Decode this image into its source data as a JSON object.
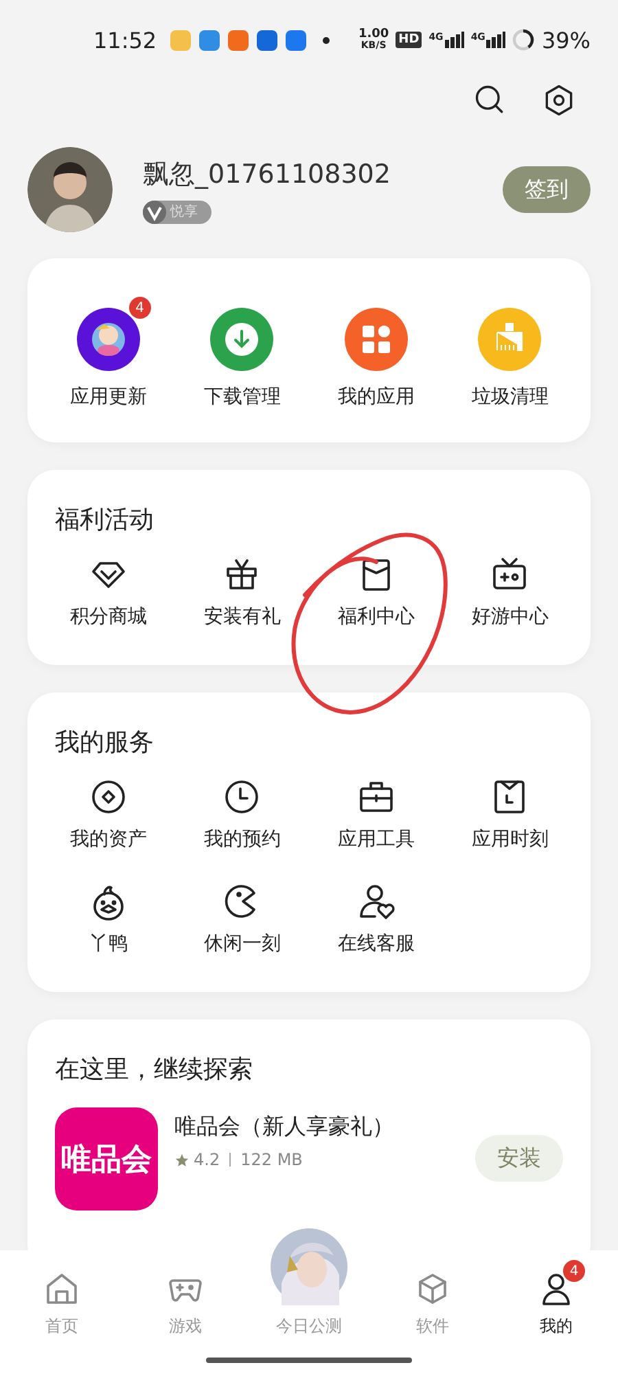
{
  "status_bar": {
    "time": "11:52",
    "net_speed": "1.00",
    "net_unit": "KB/S",
    "hd": "HD",
    "signal_1": "4G",
    "signal_2": "4G",
    "battery": "39%"
  },
  "profile": {
    "name": "飘忽_01761108302",
    "badge": "悦享",
    "checkin_button": "签到"
  },
  "shortcuts": [
    {
      "label": "应用更新",
      "kind": "update",
      "badge": "4"
    },
    {
      "label": "下载管理",
      "kind": "download"
    },
    {
      "label": "我的应用",
      "kind": "apps"
    },
    {
      "label": "垃圾清理",
      "kind": "clean"
    }
  ],
  "welfare": {
    "title": "福利活动",
    "items": [
      {
        "label": "积分商城",
        "kind": "diamond"
      },
      {
        "label": "安装有礼",
        "kind": "gift"
      },
      {
        "label": "福利中心",
        "kind": "envelope"
      },
      {
        "label": "好游中心",
        "kind": "tv"
      }
    ]
  },
  "services": {
    "title": "我的服务",
    "items": [
      {
        "label": "我的资产",
        "kind": "coin"
      },
      {
        "label": "我的预约",
        "kind": "clock"
      },
      {
        "label": "应用工具",
        "kind": "toolbox"
      },
      {
        "label": "应用时刻",
        "kind": "calendar"
      },
      {
        "label": "丫鸭",
        "kind": "duck"
      },
      {
        "label": "休闲一刻",
        "kind": "pacman"
      },
      {
        "label": "在线客服",
        "kind": "support"
      }
    ]
  },
  "explore": {
    "title": "在这里，继续探索",
    "app": {
      "icon_text": "唯品会",
      "name": "唯品会（新人享豪礼）",
      "rating": "4.2",
      "size": "122 MB",
      "install_button": "安装"
    }
  },
  "bottom_nav": [
    {
      "label": "首页",
      "kind": "home",
      "selected": false
    },
    {
      "label": "游戏",
      "kind": "game",
      "selected": false
    },
    {
      "label": "今日公测",
      "kind": "featured",
      "selected": false
    },
    {
      "label": "软件",
      "kind": "software",
      "selected": false
    },
    {
      "label": "我的",
      "kind": "me",
      "selected": true,
      "badge": "4"
    }
  ]
}
